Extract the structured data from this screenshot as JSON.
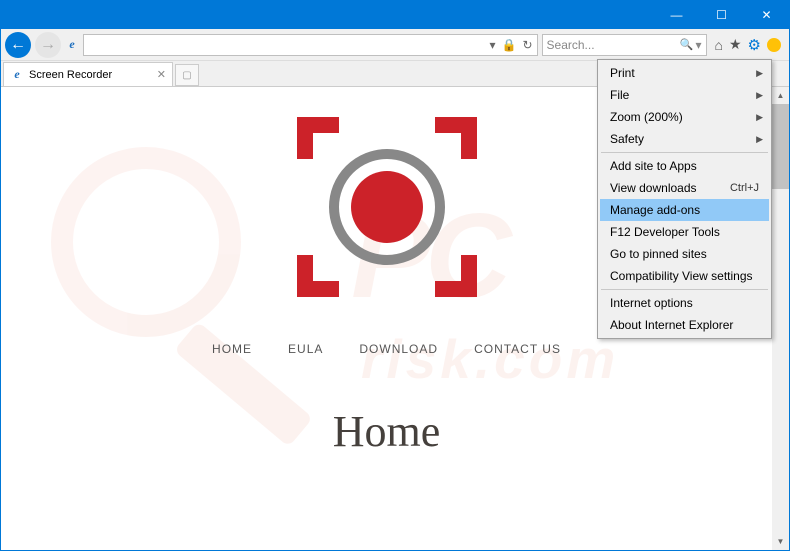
{
  "titlebar": {
    "min": "—",
    "max": "☐",
    "close": "✕"
  },
  "nav": {
    "back": "←",
    "fwd": "→"
  },
  "address": {
    "dropdown": "▾",
    "lock": "🔒",
    "refresh": "↻"
  },
  "search": {
    "placeholder": "Search...",
    "dropdown": "▾",
    "mag": "🔍"
  },
  "tools": {
    "home": "⌂",
    "star": "★",
    "gear": "⚙",
    "ie_e": "e"
  },
  "tab": {
    "favicon": "e",
    "title": "Screen Recorder",
    "close": "✕",
    "new": "▢"
  },
  "page": {
    "nav": [
      "HOME",
      "EULA",
      "DOWNLOAD",
      "CONTACT US"
    ],
    "heading": "Home"
  },
  "watermark": {
    "big": "PC",
    "sub": "risk.com"
  },
  "menu": {
    "items": [
      {
        "label": "Print",
        "submenu": true
      },
      {
        "label": "File",
        "submenu": true
      },
      {
        "label": "Zoom (200%)",
        "submenu": true
      },
      {
        "label": "Safety",
        "submenu": true
      },
      {
        "sep": true
      },
      {
        "label": "Add site to Apps"
      },
      {
        "label": "View downloads",
        "shortcut": "Ctrl+J"
      },
      {
        "label": "Manage add-ons",
        "selected": true
      },
      {
        "label": "F12 Developer Tools"
      },
      {
        "label": "Go to pinned sites"
      },
      {
        "label": "Compatibility View settings"
      },
      {
        "sep": true
      },
      {
        "label": "Internet options"
      },
      {
        "label": "About Internet Explorer"
      }
    ]
  },
  "scrollbar": {
    "up": "▲",
    "down": "▼"
  }
}
